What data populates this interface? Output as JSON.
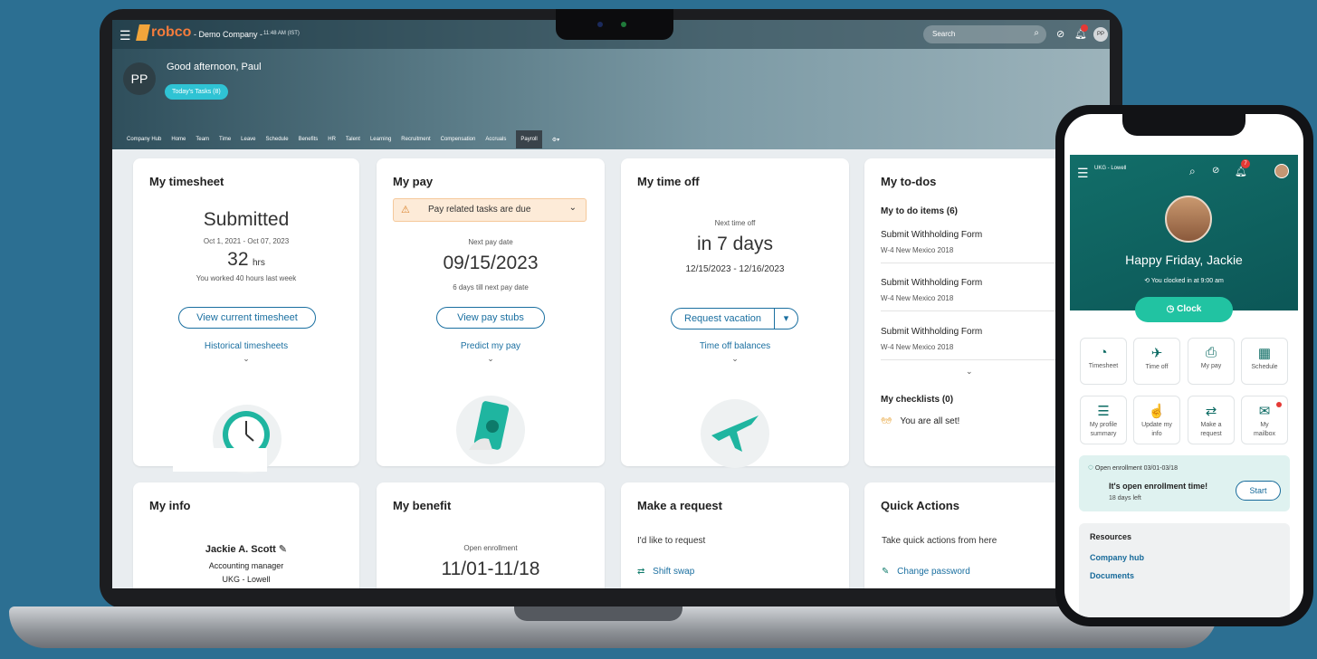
{
  "laptop": {
    "header": {
      "company": "- Demo Company -",
      "time": "11:48 AM (IST)",
      "search_placeholder": "Search",
      "avatar_initials": "PP",
      "greeting": "Good afternoon, Paul",
      "todays_tasks": "Today's Tasks (8)",
      "nav": [
        "Company Hub",
        "Home",
        "Team",
        "Time",
        "Leave",
        "Schedule",
        "Benefits",
        "HR",
        "Talent",
        "Learning",
        "Recruitment",
        "Compensation",
        "Accruals",
        "Payroll"
      ]
    },
    "timesheet": {
      "title": "My timesheet",
      "status": "Submitted",
      "range": "Oct 1, 2021 - Oct 07, 2023",
      "hours": "32",
      "hours_unit": "hrs",
      "note": "You worked 40 hours last week",
      "button": "View current timesheet",
      "link": "Historical timesheets"
    },
    "pay": {
      "title": "My pay",
      "alert": "Pay related tasks are due",
      "next_label": "Next pay date",
      "date": "09/15/2023",
      "note": "6 days till next pay date",
      "button": "View pay stubs",
      "link": "Predict my pay"
    },
    "timeoff": {
      "title": "My time off",
      "next_label": "Next time off",
      "when": "in 7 days",
      "range": "12/15/2023 - 12/16/2023",
      "button": "Request vacation",
      "link": "Time off balances"
    },
    "todos": {
      "title": "My to-dos",
      "subtitle": "My to do items (6)",
      "items": [
        {
          "title": "Submit Withholding Form",
          "sub": "W-4 New Mexico 2018"
        },
        {
          "title": "Submit Withholding Form",
          "sub": "W-4 New Mexico 2018"
        },
        {
          "title": "Submit Withholding Form",
          "sub": "W-4 New Mexico 2018"
        }
      ],
      "checklists": "My checklists (0)",
      "all_set": "You are all set!"
    },
    "info": {
      "title": "My info",
      "name": "Jackie A. Scott",
      "role": "Accounting manager",
      "location": "UKG - Lowell"
    },
    "benefit": {
      "title": "My benefit",
      "label": "Open enrollment",
      "range": "11/01-11/18"
    },
    "request": {
      "title": "Make a request",
      "prompt": "I'd like to request",
      "item": "Shift swap"
    },
    "quick": {
      "title": "Quick Actions",
      "prompt": "Take quick actions from here",
      "item": "Change password"
    }
  },
  "phone": {
    "org": "UKG - Lowell",
    "bell_count": "7",
    "greeting": "Happy Friday, Jackie",
    "clocked": "You clocked in at 9:00 am",
    "clock_button": "Clock",
    "tiles": [
      {
        "label": "Timesheet",
        "icon": "timesheet-icon",
        "glyph": "◔"
      },
      {
        "label": "Time off",
        "icon": "plane-icon",
        "glyph": "✈"
      },
      {
        "label": "My pay",
        "icon": "pay-icon",
        "glyph": "⎙"
      },
      {
        "label": "Schedule",
        "icon": "calendar-icon",
        "glyph": "▦"
      },
      {
        "label": "My profile summary",
        "icon": "profile-icon",
        "glyph": "☰"
      },
      {
        "label": "Update my info",
        "icon": "hand-icon",
        "glyph": "☝"
      },
      {
        "label": "Make a request",
        "icon": "swap-icon",
        "glyph": "⇄"
      },
      {
        "label": "My mailbox",
        "icon": "mail-icon",
        "glyph": "✉"
      }
    ],
    "enroll_dates": "Open enrollment 03/01-03/18",
    "enroll_title": "It's open enrollment time!",
    "enroll_left": "18 days left",
    "start": "Start",
    "resources_title": "Resources",
    "resources": [
      "Company hub",
      "Documents"
    ]
  },
  "colors": {
    "background": "#2c6f92",
    "link": "#1a6fa0",
    "phone_teal": "#0c5757",
    "clock_green": "#21c3a2"
  }
}
